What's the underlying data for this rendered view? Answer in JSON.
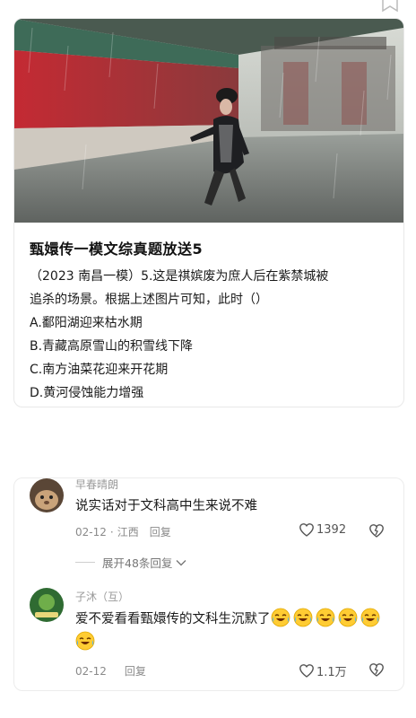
{
  "post": {
    "title": "甄嬛传一模文综真题放送5",
    "question": [
      "（2023 南昌一模）5.这是祺嫔废为庶人后在紫禁城被",
      "追杀的场景。根据上述图片可知，此时（）"
    ],
    "options": [
      "A.鄱阳湖迎来枯水期",
      "B.青藏高原雪山的积雪线下降",
      "C.南方油菜花迎来开花期",
      "D.黄河侵蚀能力增强"
    ]
  },
  "comments": [
    {
      "username": "早春晴朗",
      "text": "说实话对于文科高中生来说不难",
      "date": "02-12",
      "location": "江西",
      "reply_label": "回复",
      "likes": "1392",
      "expand_label": "展开48条回复"
    },
    {
      "username": "子沐（互）",
      "text": "爱不爱看看甄嬛传的文科生沉默了",
      "emoji_count": 6,
      "date": "02-12",
      "reply_label": "回复",
      "likes": "1.1万"
    }
  ],
  "colors": {
    "accent_wall": "#b8262e",
    "text": "#1a1a1a",
    "muted": "#8a8a8a"
  }
}
